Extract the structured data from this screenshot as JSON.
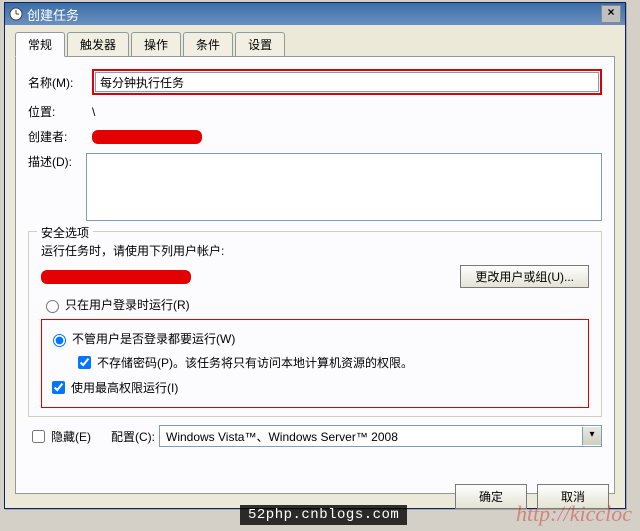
{
  "window": {
    "title": "创建任务"
  },
  "tabs": [
    "常规",
    "触发器",
    "操作",
    "条件",
    "设置"
  ],
  "general": {
    "name_label": "名称(M):",
    "name_value": "每分钟执行任务",
    "location_label": "位置:",
    "location_value": "\\",
    "author_label": "创建者:",
    "desc_label": "描述(D):"
  },
  "security": {
    "group_title": "安全选项",
    "run_as_label": "运行任务时，请使用下列用户帐户:",
    "change_user_btn": "更改用户或组(U)...",
    "radio_logged_on": "只在用户登录时运行(R)",
    "radio_always": "不管用户是否登录都要运行(W)",
    "no_password": "不存储密码(P)。该任务将只有访问本地计算机资源的权限。",
    "highest_priv": "使用最高权限运行(I)"
  },
  "bottom": {
    "hidden_label": "隐藏(E)",
    "config_label": "配置(C):",
    "config_value": "Windows Vista™、Windows Server™ 2008"
  },
  "buttons": {
    "ok": "确定",
    "cancel": "取消"
  },
  "watermark1": "52php.cnblogs.com",
  "watermark2": "http://kiccloc"
}
